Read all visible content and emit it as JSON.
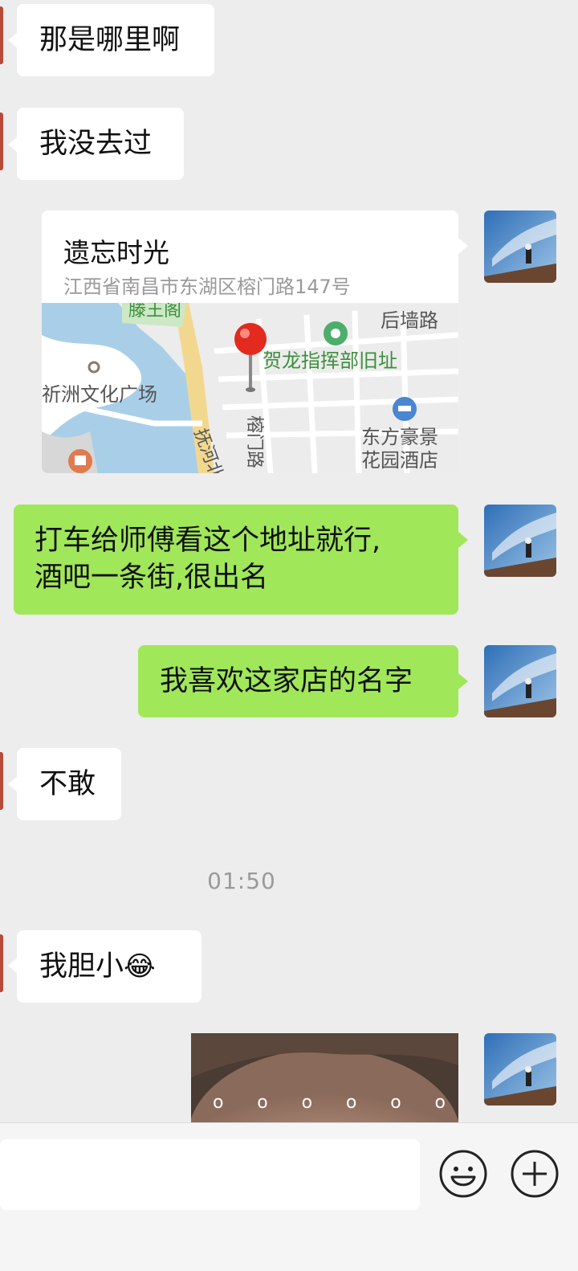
{
  "messages": {
    "m1": "那是哪里啊",
    "m2": "我没去过",
    "m3_line1": "打车给师傅看这个地址就行,",
    "m3_line2": "酒吧一条街,很出名",
    "m4": "我喜欢这家店的名字",
    "m5": "不敢",
    "m6": "我胆小"
  },
  "location": {
    "name": "遗忘时光",
    "address": "江西省南昌市东湖区榕门路147号",
    "map": {
      "label_top": "滕王阁",
      "label_road1": "后墙路",
      "label_poi": "贺龙指挥部旧址",
      "label_square": "祈洲文化广场",
      "label_river": "抚河北",
      "label_street": "榕门路",
      "label_hotel_line1": "东方豪景",
      "label_hotel_line2": "花园酒店"
    }
  },
  "timestamp": "01:50",
  "emoji": "😂",
  "image_dots": [
    "o",
    "o",
    "o",
    "o",
    "o",
    "o"
  ],
  "icons": {
    "emoji_button": "smiley-icon",
    "more_button": "plus-circle-icon"
  },
  "colors": {
    "background": "#ededed",
    "bubble_self": "#a0e75a",
    "bubble_other": "#ffffff",
    "timestamp": "#9a9a9a"
  }
}
